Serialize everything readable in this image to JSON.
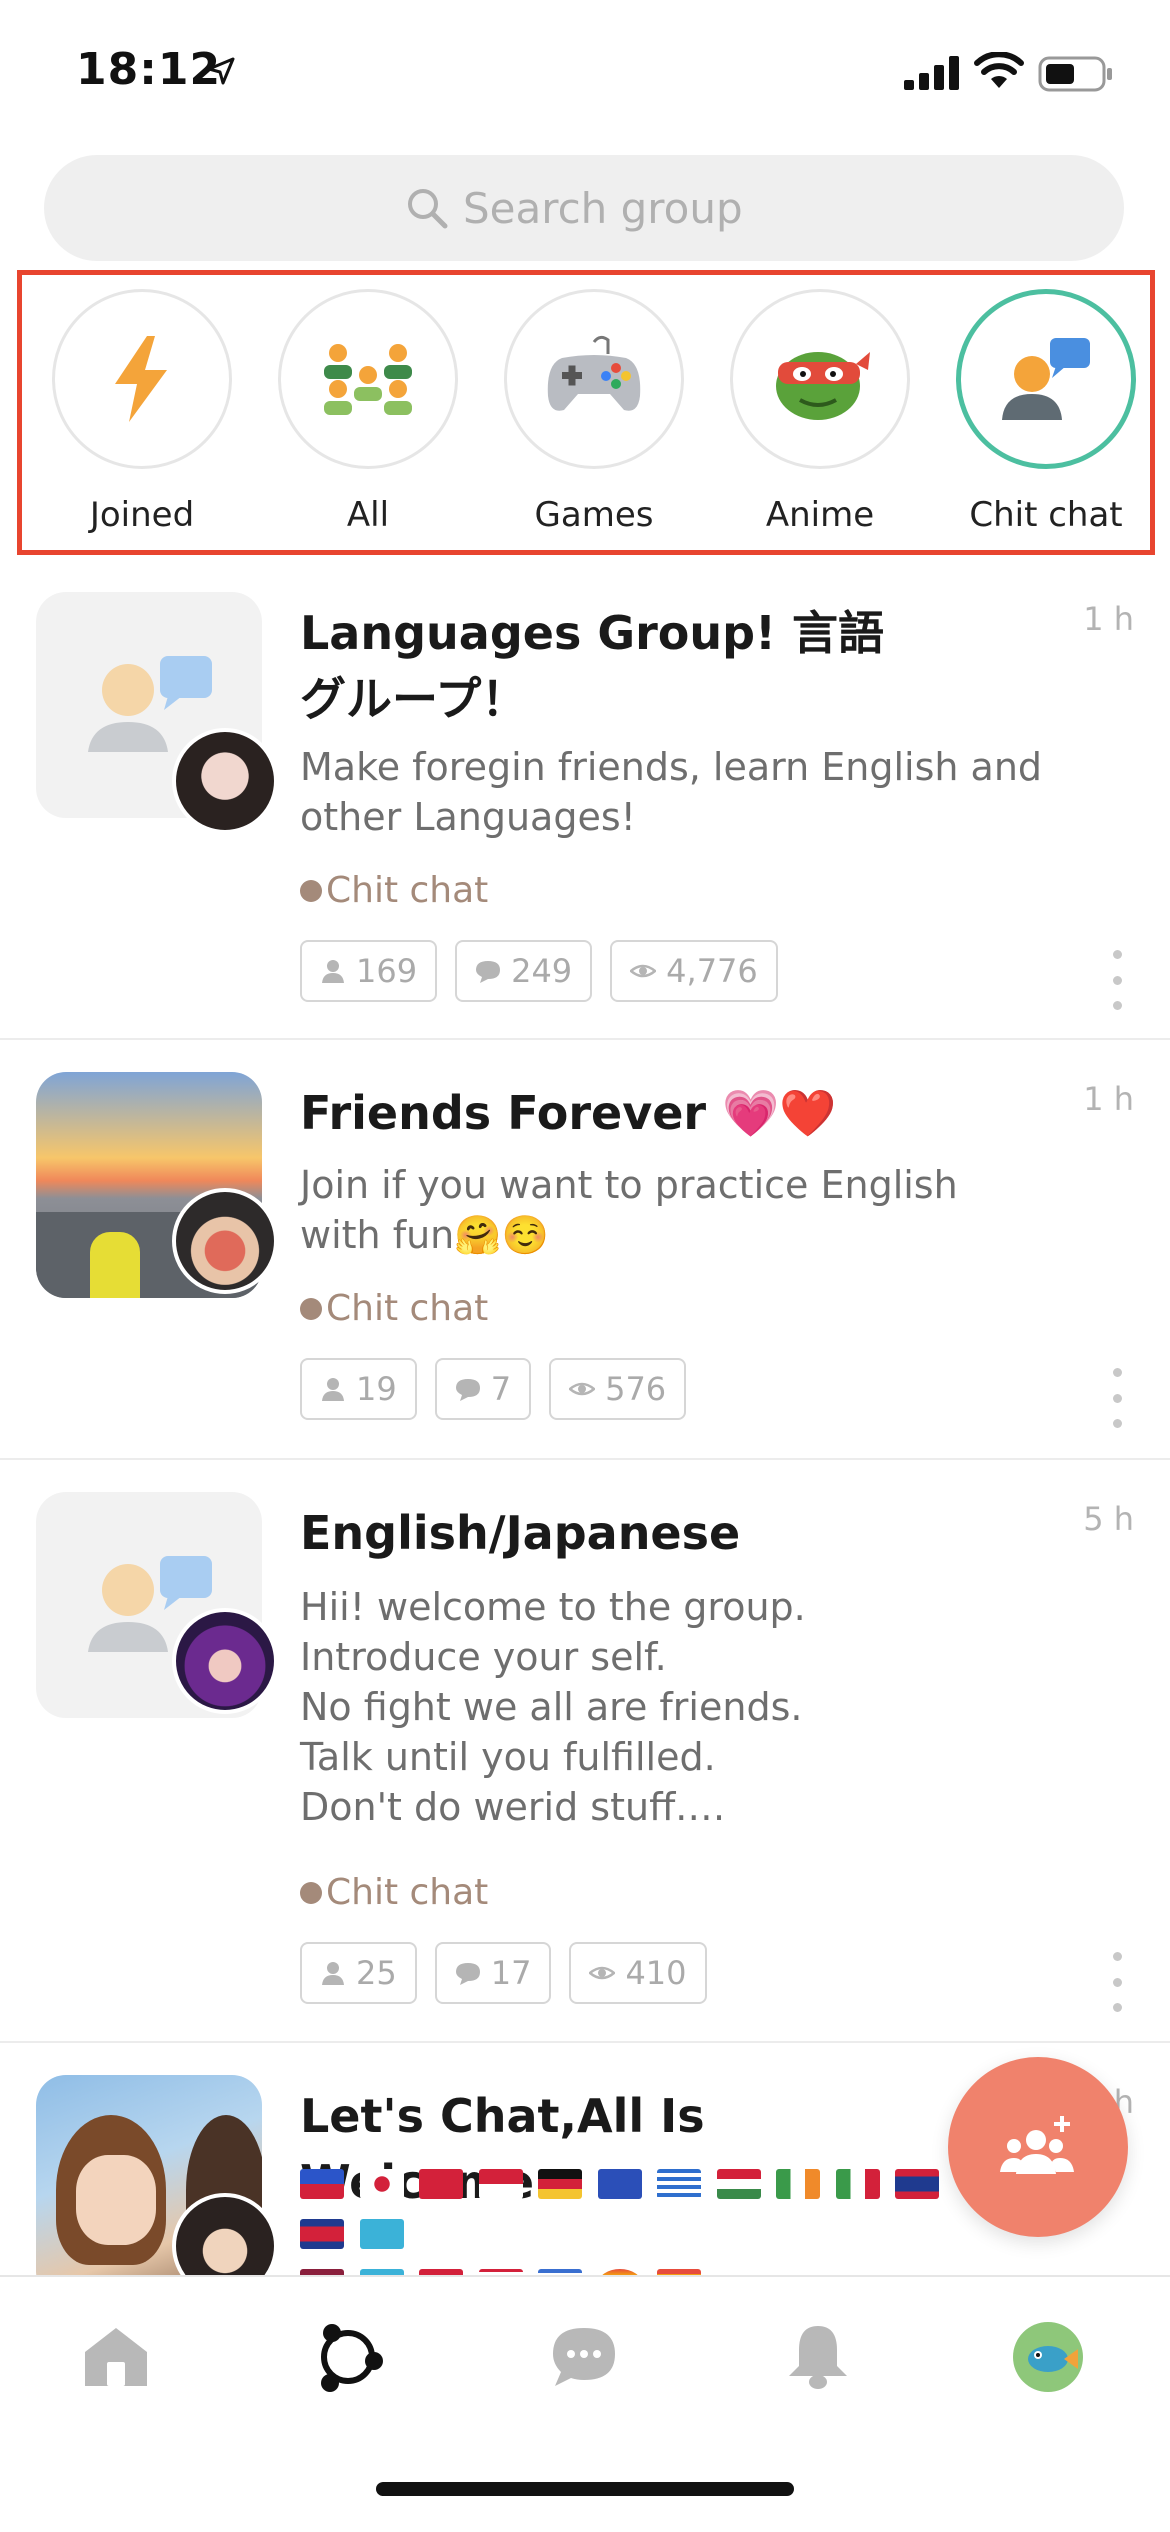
{
  "status_bar": {
    "time": "18:12"
  },
  "search": {
    "placeholder": "Search group"
  },
  "categories": [
    {
      "label": "Joined",
      "icon": "lightning-icon"
    },
    {
      "label": "All",
      "icon": "people-group-icon"
    },
    {
      "label": "Games",
      "icon": "gamepad-icon"
    },
    {
      "label": "Anime",
      "icon": "ninja-turtle-icon"
    },
    {
      "label": "Chit chat",
      "icon": "chat-person-icon",
      "selected": true
    }
  ],
  "groups": [
    {
      "title": "Languages Group!  言語グループ！",
      "time": "1 h",
      "description": "Make foregin friends, learn English and other Languages!",
      "tag": "Chit chat",
      "members": "169",
      "comments": "249",
      "views": "4,776"
    },
    {
      "title": "Friends Forever 💗❤️",
      "time": "1 h",
      "description": "Join if you want to practice English with fun🤗☺️",
      "tag": "Chit chat",
      "members": "19",
      "comments": "7",
      "views": "576"
    },
    {
      "title": "English/Japanese",
      "time": "5 h",
      "description_lines": [
        "Hii! welcome to the group.",
        "Introduce your self.",
        "No fight we all are friends.",
        "Talk until you fulfilled.",
        "Don't do werid stuff.…"
      ],
      "tag": "Chit chat",
      "members": "25",
      "comments": "17",
      "views": "410"
    },
    {
      "title": "Let's Chat,All Is Welcome",
      "time": "h"
    }
  ],
  "colors": {
    "accent": "#f0826c",
    "selected_ring": "#4cbfa0",
    "highlight_box": "#e8452f",
    "tag": "#a48a7a"
  },
  "tabs": [
    "home-icon",
    "groups-icon",
    "chat-icon",
    "bell-icon",
    "profile-avatar"
  ]
}
